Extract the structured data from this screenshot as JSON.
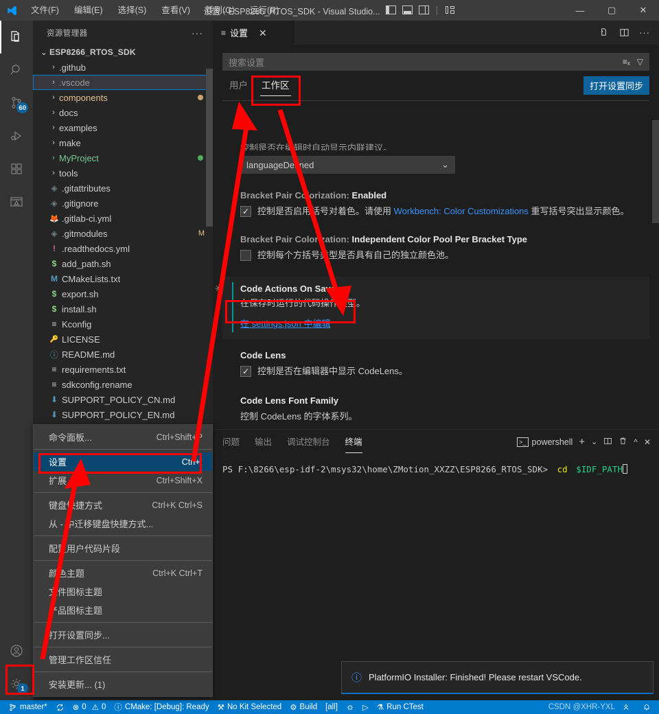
{
  "titlebar": {
    "menus": [
      "文件(F)",
      "编辑(E)",
      "选择(S)",
      "查看(V)",
      "转到(G)",
      "运行(R)"
    ],
    "more": "···",
    "window_title": "设置 - ESP8266_RTOS_SDK - Visual Studio...",
    "controls": {
      "minimize": "—",
      "maximize": "▢",
      "close": "✕"
    }
  },
  "activitybar": {
    "items": [
      {
        "name": "explorer",
        "badge": ""
      },
      {
        "name": "search",
        "badge": ""
      },
      {
        "name": "source-control",
        "badge": "60"
      },
      {
        "name": "run-debug",
        "badge": ""
      },
      {
        "name": "extensions",
        "badge": ""
      },
      {
        "name": "testing",
        "badge": ""
      }
    ],
    "bottom": [
      {
        "name": "accounts",
        "badge": ""
      },
      {
        "name": "manage",
        "badge": "1"
      }
    ]
  },
  "sidebar": {
    "header": "资源管理器",
    "more": "···",
    "root": "ESP8266_RTOS_SDK",
    "folders": [
      {
        "label": ".github",
        "dot": ""
      },
      {
        "label": ".vscode",
        "dot": "",
        "selected": true
      },
      {
        "label": "components",
        "dot": "#c9a26d"
      },
      {
        "label": "docs",
        "dot": ""
      },
      {
        "label": "examples",
        "dot": ""
      },
      {
        "label": "make",
        "dot": ""
      },
      {
        "label": "MyProject",
        "dot": "#4fae5a",
        "color": "#73c991"
      },
      {
        "label": "tools",
        "dot": ""
      }
    ],
    "files": [
      {
        "label": ".gitattributes",
        "icon": "◈",
        "color": "#6d8086",
        "badge": ""
      },
      {
        "label": ".gitignore",
        "icon": "◈",
        "color": "#6d8086",
        "badge": ""
      },
      {
        "label": ".gitlab-ci.yml",
        "icon": "🦊",
        "color": "#e24329",
        "badge": ""
      },
      {
        "label": ".gitmodules",
        "icon": "◈",
        "color": "#6d8086",
        "badge": "M"
      },
      {
        "label": ".readthedocs.yml",
        "icon": "!",
        "color": "#d16ba5",
        "badge": ""
      },
      {
        "label": "add_path.sh",
        "icon": "$",
        "color": "#89d185",
        "badge": ""
      },
      {
        "label": "CMakeLists.txt",
        "icon": "M",
        "color": "#519aba",
        "badge": ""
      },
      {
        "label": "export.sh",
        "icon": "$",
        "color": "#89d185",
        "badge": ""
      },
      {
        "label": "install.sh",
        "icon": "$",
        "color": "#89d185",
        "badge": ""
      },
      {
        "label": "Kconfig",
        "icon": "≡",
        "color": "#cccccc",
        "badge": ""
      },
      {
        "label": "LICENSE",
        "icon": "🔑",
        "color": "#e5c07b",
        "badge": ""
      },
      {
        "label": "README.md",
        "icon": "ⓘ",
        "color": "#519aba",
        "badge": ""
      },
      {
        "label": "requirements.txt",
        "icon": "≡",
        "color": "#cccccc",
        "badge": ""
      },
      {
        "label": "sdkconfig.rename",
        "icon": "≡",
        "color": "#cccccc",
        "badge": ""
      },
      {
        "label": "SUPPORT_POLICY_CN.md",
        "icon": "⬇",
        "color": "#519aba",
        "badge": ""
      },
      {
        "label": "SUPPORT_POLICY_EN.md",
        "icon": "⬇",
        "color": "#519aba",
        "badge": ""
      }
    ]
  },
  "context_menu": {
    "items": [
      {
        "label": "命令面板...",
        "key": "Ctrl+Shift+P",
        "selected": false,
        "sep_after": true
      },
      {
        "label": "设置",
        "key": "Ctrl+,",
        "selected": true,
        "sep_after": false
      },
      {
        "label": "扩展",
        "key": "Ctrl+Shift+X",
        "selected": false,
        "sep_after": true
      },
      {
        "label": "键盘快捷方式",
        "key": "Ctrl+K Ctrl+S",
        "selected": false,
        "sep_after": false
      },
      {
        "label": "从 - 中迁移键盘快捷方式...",
        "key": "",
        "selected": false,
        "sep_after": true
      },
      {
        "label": "配置用户代码片段",
        "key": "",
        "selected": false,
        "sep_after": true
      },
      {
        "label": "颜色主题",
        "key": "Ctrl+K Ctrl+T",
        "selected": false,
        "sep_after": false
      },
      {
        "label": "文件图标主题",
        "key": "",
        "selected": false,
        "sep_after": false
      },
      {
        "label": "产品图标主题",
        "key": "",
        "selected": false,
        "sep_after": true
      },
      {
        "label": "打开设置同步...",
        "key": "",
        "selected": false,
        "sep_after": true
      },
      {
        "label": "管理工作区信任",
        "key": "",
        "selected": false,
        "sep_after": true
      },
      {
        "label": "安装更新... (1)",
        "key": "",
        "selected": false,
        "sep_after": false
      }
    ]
  },
  "editor": {
    "tab": {
      "label": "设置",
      "close": "✕"
    },
    "actions": {
      "open_json": "open-settings-json",
      "split": "split-editor",
      "more": "···"
    }
  },
  "settings": {
    "search_placeholder": "搜索设置",
    "scopes": [
      {
        "label": "用户",
        "active": false
      },
      {
        "label": "工作区",
        "active": true
      }
    ],
    "sync_button": "打开设置同步",
    "cut_text": "控制是否在编辑时自动显示内联建议。",
    "dropdown_value": "languageDefined",
    "items": [
      {
        "title_prefix": "Bracket Pair Colorization: ",
        "title_key": "Enabled",
        "desc_pre": "控制是否启用括号对着色。请使用 ",
        "link": "Workbench: Color Customizations",
        "desc_post": " 重写括号突出显示颜色。",
        "checked": true
      },
      {
        "title_prefix": "Bracket Pair Colorization: ",
        "title_key": "Independent Color Pool Per Bracket Type",
        "desc_pre": "控制每个方括号类型是否具有自己的独立颜色池。",
        "link": "",
        "desc_post": "",
        "checked": false
      }
    ],
    "highlighted": {
      "title": "Code Actions On Save",
      "desc": "在保存时运行的代码操作类型。",
      "json_link": "在 settings.json 中编辑"
    },
    "code_lens": {
      "title": "Code Lens",
      "desc": "控制是否在编辑器中显示 CodeLens。",
      "checked": true
    },
    "code_lens_font": {
      "title": "Code Lens Font Family",
      "desc": "控制 CodeLens 的字体系列。"
    }
  },
  "panel": {
    "tabs": [
      {
        "label": "问题",
        "active": false
      },
      {
        "label": "输出",
        "active": false
      },
      {
        "label": "调试控制台",
        "active": false
      },
      {
        "label": "终端",
        "active": true
      }
    ],
    "shell": "powershell",
    "actions": {
      "new": "+",
      "dropdown": "⌄",
      "split": "split-terminal",
      "kill": "trash-icon",
      "maximize": "^",
      "close": "✕"
    },
    "terminal": {
      "prompt": "PS F:\\8266\\esp-idf-2\\msys32\\home\\ZMotion_XXZZ\\ESP8266_RTOS_SDK>",
      "command": "cd",
      "argument": "$IDF_PATH"
    }
  },
  "notification": {
    "icon": "info-icon",
    "text": "PlatformIO Installer: Finished! Please restart VSCode."
  },
  "statusbar": {
    "branch": "master*",
    "sync": "sync-icon",
    "errors": "0",
    "warnings": "0",
    "cmake": "CMake: [Debug]: Ready",
    "kit": "No Kit Selected",
    "build": "Build",
    "target": "[all]",
    "debug": "debug-icon",
    "run": "run-icon",
    "ctest": "Run CTest",
    "watermark": "CSDN @XHR-YXL",
    "bell": "bell-icon",
    "remote": "remote-icon"
  },
  "colors": {
    "accent": "#007acc",
    "annotation": "#ff0000",
    "link": "#3794ff",
    "selection": "#094771",
    "badge": "#0e639c"
  }
}
